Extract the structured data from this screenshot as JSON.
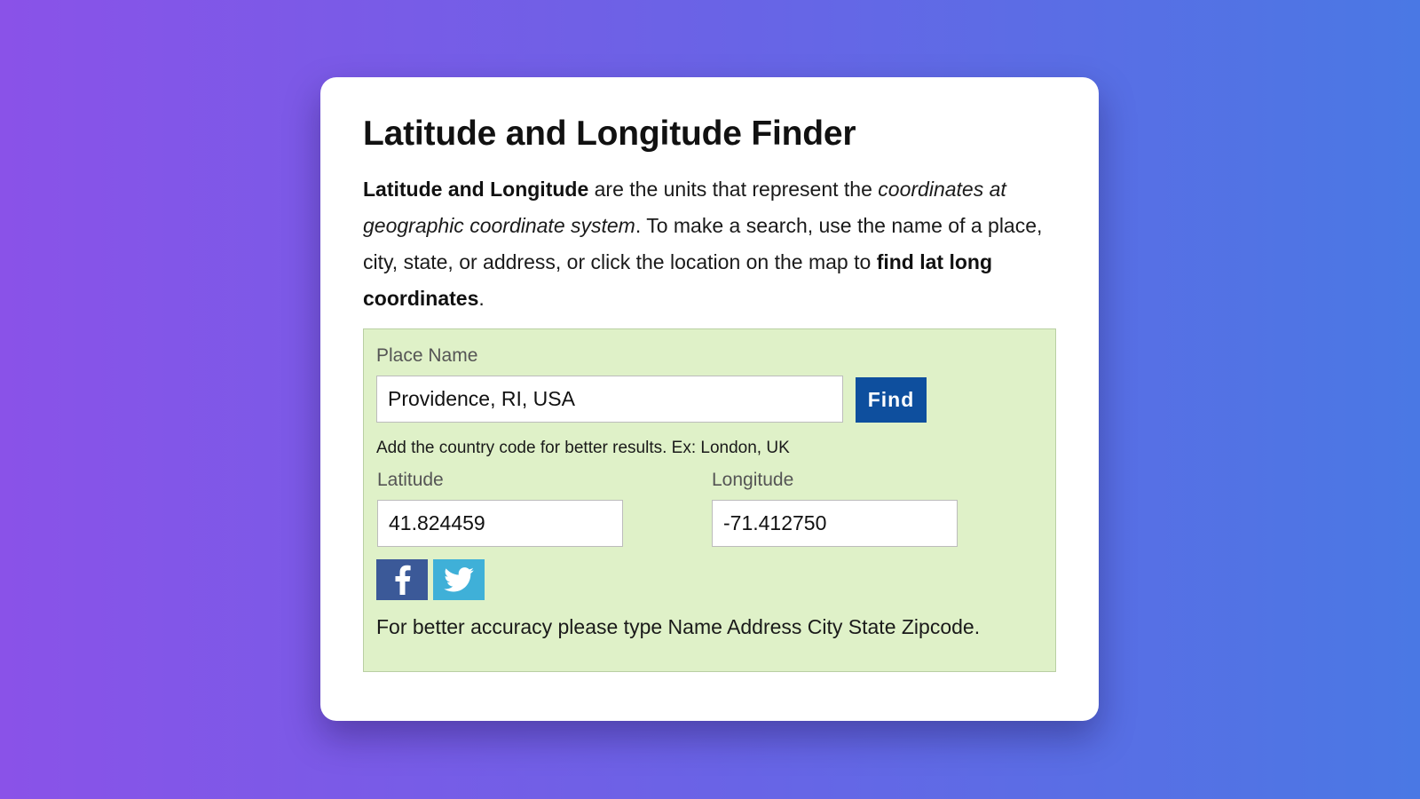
{
  "card": {
    "title": "Latitude and Longitude Finder",
    "intro": {
      "p1_bold": "Latitude and Longitude",
      "p2": " are the units that represent the ",
      "p3_italic": "coordinates at geographic coordinate system",
      "p4": ". To make a search, use the name of a place, city, state, or address, or click the location on the map to ",
      "p5_bold": "find lat long coordinates",
      "p6": "."
    }
  },
  "form": {
    "place_label": "Place Name",
    "place_value": "Providence, RI, USA",
    "find_label": "Find",
    "hint": "Add the country code for better results. Ex: London, UK",
    "lat_label": "Latitude",
    "lat_value": "41.824459",
    "lng_label": "Longitude",
    "lng_value": "-71.412750",
    "social": [
      {
        "name": "facebook-icon",
        "color": "#3b5998"
      },
      {
        "name": "twitter-icon",
        "color": "#3fb0d8"
      }
    ],
    "note": "For better accuracy please type Name Address City State Zipcode."
  },
  "colors": {
    "panel_bg": "#dff1c8",
    "button_bg": "#0e4f9e",
    "background_start": "#8a52e8",
    "background_end": "#4a78e4"
  }
}
